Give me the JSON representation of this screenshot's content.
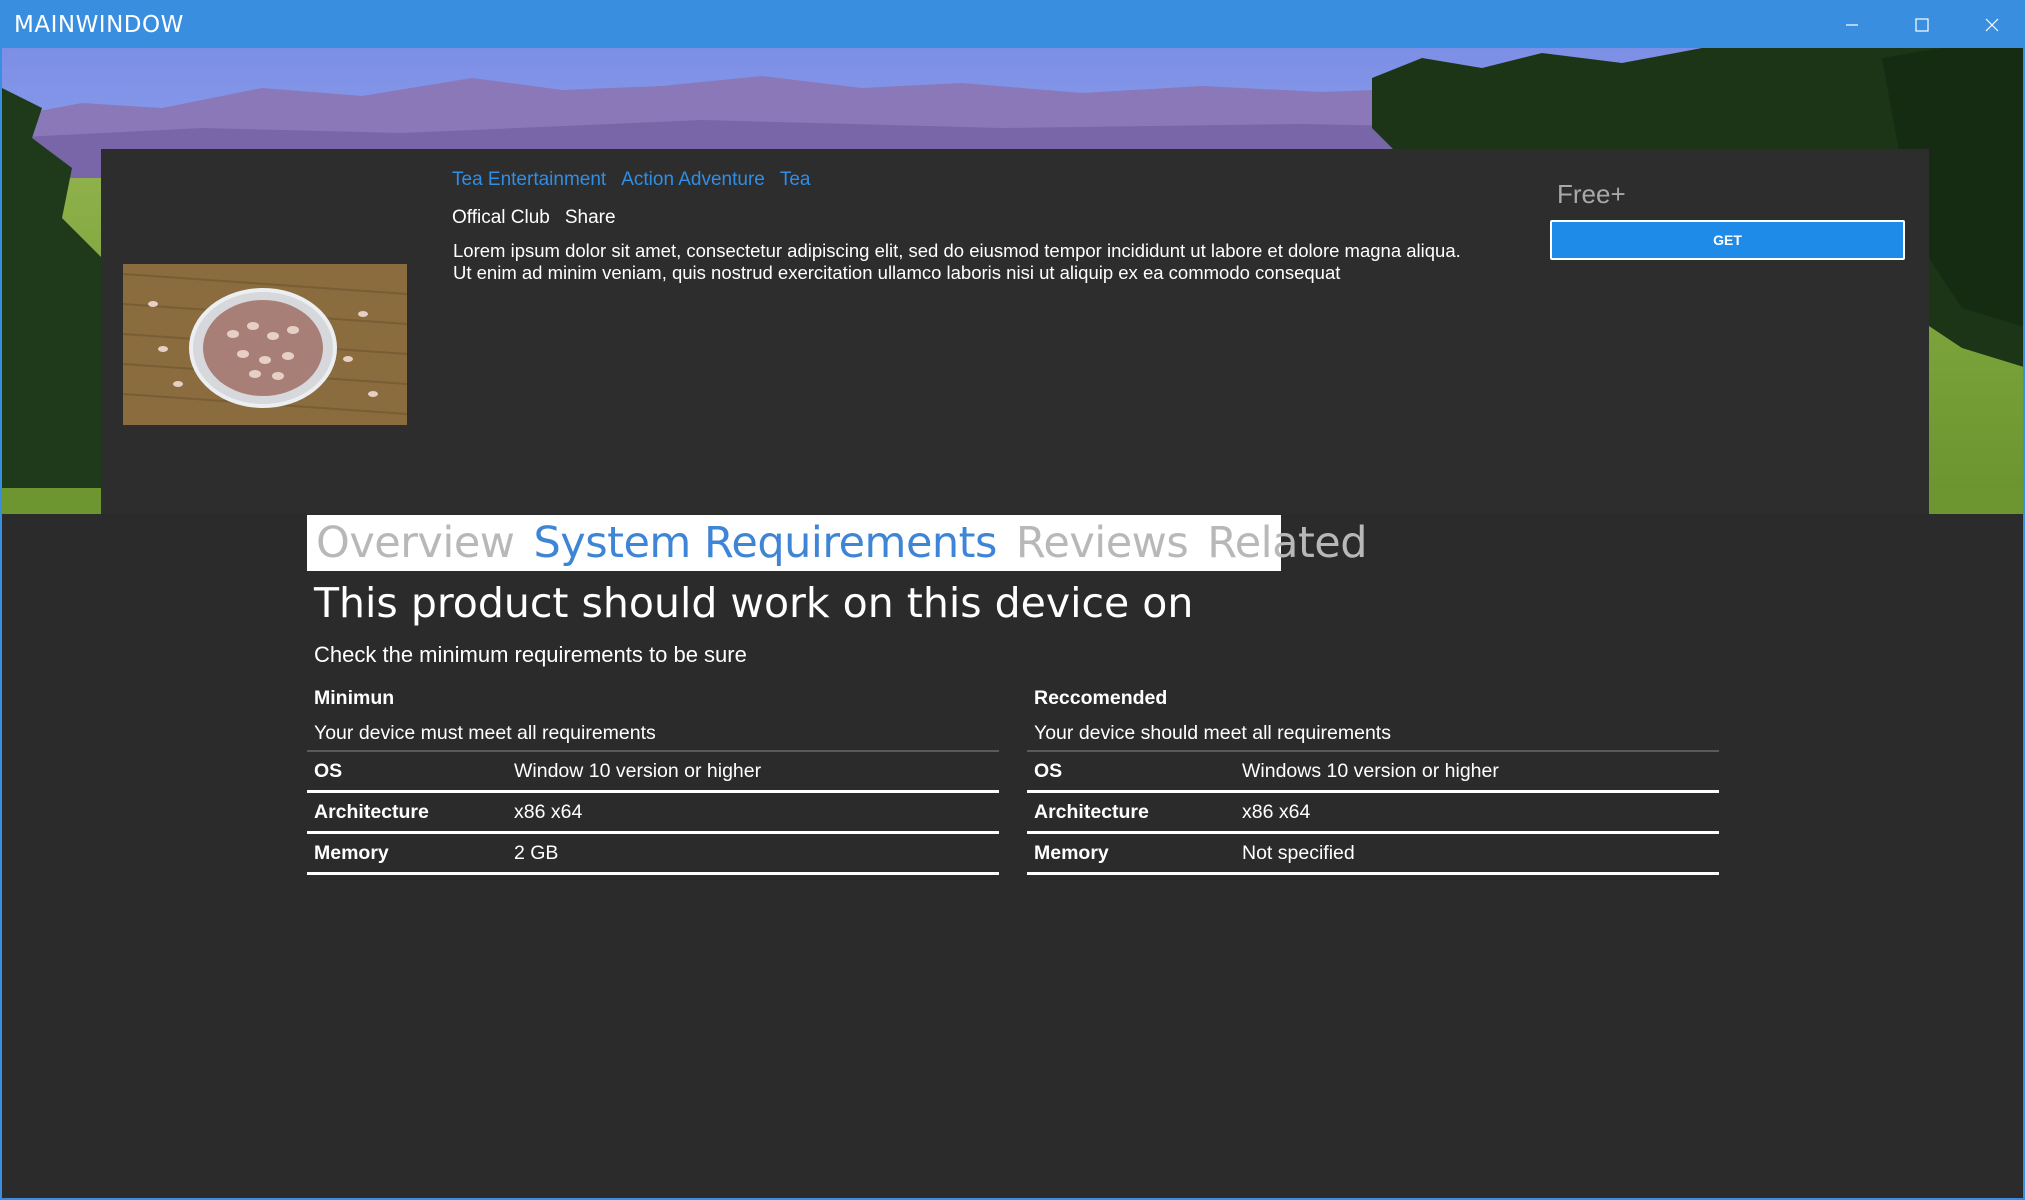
{
  "window": {
    "title": "MAINWINDOW",
    "accent_color": "#3a8ee0"
  },
  "product": {
    "categories": [
      "Tea Entertainment",
      "Action Adventure",
      "Tea"
    ],
    "links": [
      "Offical Club",
      "Share"
    ],
    "description": "Lorem ipsum dolor sit amet, consectetur adipiscing elit, sed do eiusmod tempor incididunt ut labore et dolore magna aliqua. Ut enim ad minim veniam, quis nostrud exercitation ullamco laboris nisi ut aliquip ex ea commodo consequat",
    "price": "Free+",
    "get_label": "GET",
    "thumbnail_icon": "beans-bowl-image",
    "hero_icon": "mountain-meadow-image"
  },
  "tabs": [
    {
      "label": "Overview",
      "active": false
    },
    {
      "label": "System Requirements",
      "active": true
    },
    {
      "label": "Reviews",
      "active": false
    },
    {
      "label": "Related",
      "active": false
    }
  ],
  "requirements": {
    "heading": "This product should work on this device on",
    "subheading": "Check the minimum requirements to be sure",
    "minimum": {
      "title": "Minimun",
      "subtitle": "Your device must meet all requirements",
      "rows": [
        {
          "key": "OS",
          "value": "Window 10 version or higher"
        },
        {
          "key": "Architecture",
          "value": "x86 x64"
        },
        {
          "key": "Memory",
          "value": "2 GB"
        }
      ]
    },
    "recommended": {
      "title": "Reccomended",
      "subtitle": "Your device should meet all requirements",
      "rows": [
        {
          "key": "OS",
          "value": "Windows 10 version or higher"
        },
        {
          "key": "Architecture",
          "value": "x86 x64"
        },
        {
          "key": "Memory",
          "value": "Not specified"
        }
      ]
    }
  }
}
